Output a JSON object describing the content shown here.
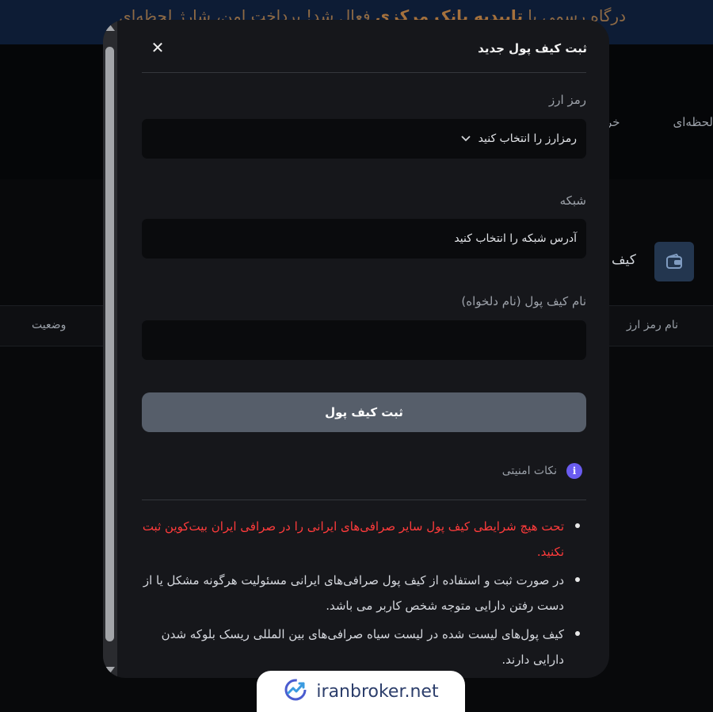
{
  "background": {
    "banner_text_a": "درگاه رسمی با ",
    "banner_text_bold": "تاییدیه بانک مرکزی",
    "banner_text_b": " فعال شد! پرداخت امن، شارژ لحظه‌ای",
    "nav_items": [
      "لحظه‌ای",
      "خر"
    ],
    "page_title": "کیف",
    "table_headers": [
      "نام رمز ارز",
      "وضعیت"
    ]
  },
  "modal": {
    "title": "ثبت کیف پول جدید",
    "close_label": "✕",
    "currency": {
      "label": "رمز ارز",
      "value": "رمزارز را انتخاب کنید"
    },
    "network": {
      "label": "شبکه",
      "value": "آدرس شبکه را انتخاب کنید"
    },
    "wallet_name": {
      "label": "نام کیف پول (نام دلخواه)",
      "value": ""
    },
    "submit_label": "ثبت کیف پول",
    "security": {
      "label": "نکات امنیتی",
      "icon_glyph": "i",
      "notes": [
        "تحت هیچ شرایطی کیف پول سایر صرافی‌های ایرانی را در صرافی ایران بیت‌کوین ثبت نکنید.",
        "در صورت ثبت و استفاده از کیف پول صرافی‌های ایرانی مسئولیت هرگونه مشکل یا از دست رفتن دارایی متوجه شخص کاربر می باشد.",
        "کیف پول‌های لیست شده در لیست سیاه صرافی‌های بین المللی ریسک بلوکه شدن دارایی دارند."
      ]
    }
  },
  "watermark": {
    "text": "iranbroker.net"
  },
  "colors": {
    "modal_bg": "#16171b",
    "field_bg": "#0a0b0d",
    "submit_bg": "#565e6a",
    "warning": "#ff3b3b",
    "info_accent": "#6a5cf0"
  }
}
